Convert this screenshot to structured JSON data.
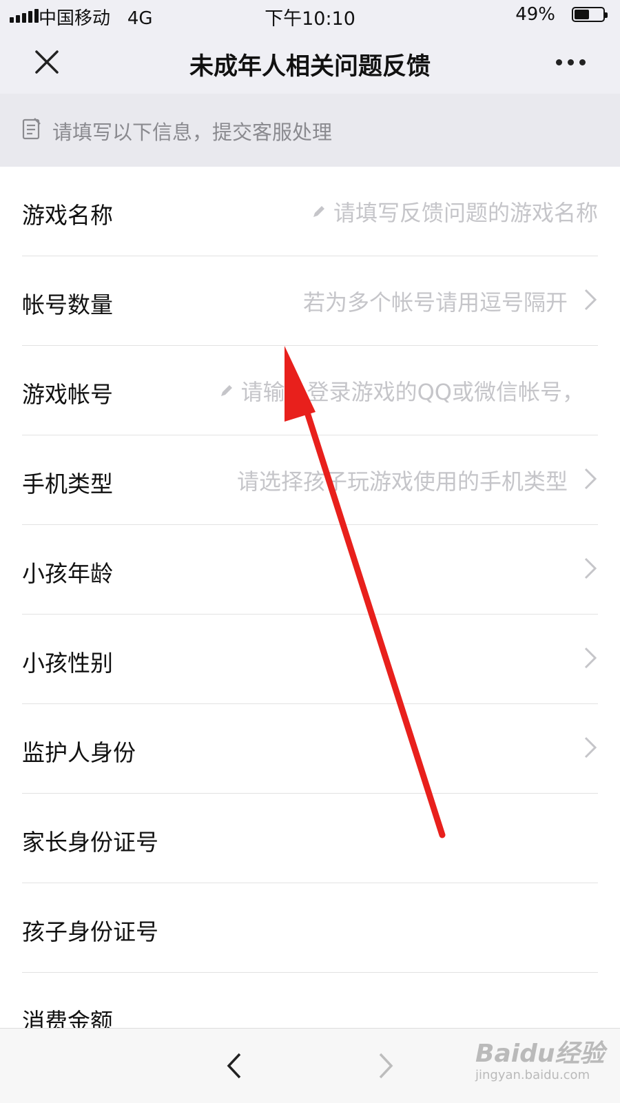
{
  "status_bar": {
    "carrier": "中国移动",
    "network": "4G",
    "time": "下午10:10",
    "battery_percent": "49%",
    "battery_level": 0.49
  },
  "nav": {
    "title": "未成年人相关问题反馈",
    "close_icon": "close-icon",
    "more_icon": "more-icon"
  },
  "notice": {
    "icon": "document-icon",
    "text": "请填写以下信息，提交客服处理"
  },
  "form": {
    "rows": [
      {
        "label": "游戏名称",
        "placeholder": "请填写反馈问题的游戏名称",
        "type": "text-input"
      },
      {
        "label": "帐号数量",
        "placeholder": "若为多个帐号请用逗号隔开",
        "type": "select"
      },
      {
        "label": "游戏帐号",
        "placeholder": "请输入登录游戏的QQ或微信帐号，",
        "type": "text-input"
      },
      {
        "label": "手机类型",
        "placeholder": "请选择孩子玩游戏使用的手机类型",
        "type": "select"
      },
      {
        "label": "小孩年龄",
        "placeholder": "",
        "type": "select"
      },
      {
        "label": "小孩性别",
        "placeholder": "",
        "type": "select"
      },
      {
        "label": "监护人身份",
        "placeholder": "",
        "type": "select"
      },
      {
        "label": "家长身份证号",
        "placeholder": "",
        "type": "text-input"
      },
      {
        "label": "孩子身份证号",
        "placeholder": "",
        "type": "text-input"
      },
      {
        "label": "消费金额",
        "placeholder": "",
        "type": "text-input"
      }
    ]
  },
  "bottom_bar": {
    "back_icon": "chevron-left-icon",
    "forward_icon": "chevron-right-icon"
  },
  "watermark": {
    "main": "Baidu经验",
    "sub": "jingyan.baidu.com"
  },
  "annotation": {
    "arrow_color": "#e8201c"
  },
  "colors": {
    "header_bg": "#efeff4",
    "notice_bg": "#e9e9ee",
    "placeholder": "#c5c5c9"
  }
}
